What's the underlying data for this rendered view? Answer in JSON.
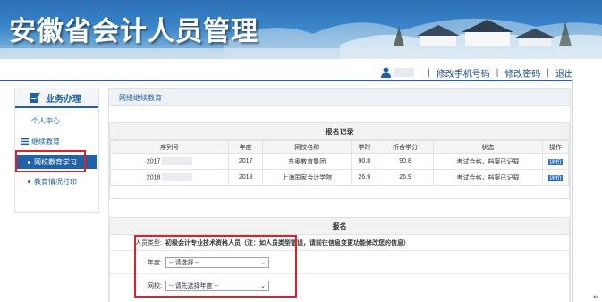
{
  "banner": {
    "title": "安徽省会计人员管理"
  },
  "userbar": {
    "user_icon": "user-icon",
    "links": [
      "修改手机号码",
      "修改密码",
      "退出"
    ],
    "separator": "|"
  },
  "sidebar": {
    "heading": "业务办理",
    "items": {
      "personal_center": "个人中心",
      "continuing_edu": "继续教育",
      "online_learning": "网校教育学习",
      "print_edu": "教育情况打印"
    }
  },
  "main": {
    "header": "网络继续教育",
    "records": {
      "title": "报名记录",
      "columns": [
        "序列号",
        "年度",
        "网校名称",
        "学时",
        "折合学分",
        "状态",
        "操作"
      ],
      "rows": [
        {
          "serial": "2017",
          "year": "2017",
          "school": "东奥教育集团",
          "hours": "90.8",
          "credits": "90.8",
          "status": "考试合格，档案已记载",
          "op": "评价"
        },
        {
          "serial": "2018",
          "year": "2018",
          "school": "上海国家会计学院",
          "hours": "26.9",
          "credits": "26.9",
          "status": "考试合格，档案已记载",
          "op": "评价"
        }
      ]
    },
    "signup": {
      "title": "报名",
      "person_type_label": "人员类型:",
      "person_type_value": "初级会计专业技术资格人员（注：如人员类型错误，请前往信息变更功能修改您的信息）",
      "year_label": "年度:",
      "year_placeholder": "-- 请选择 --",
      "school_label": "网校:",
      "school_placeholder": "-- 请先选择年度 --"
    }
  },
  "colors": {
    "accent": "#1f5fa4",
    "highlight_box": "#e0202a",
    "active_bg": "#1f62a8"
  },
  "misc": {
    "return_mark": "↵"
  }
}
